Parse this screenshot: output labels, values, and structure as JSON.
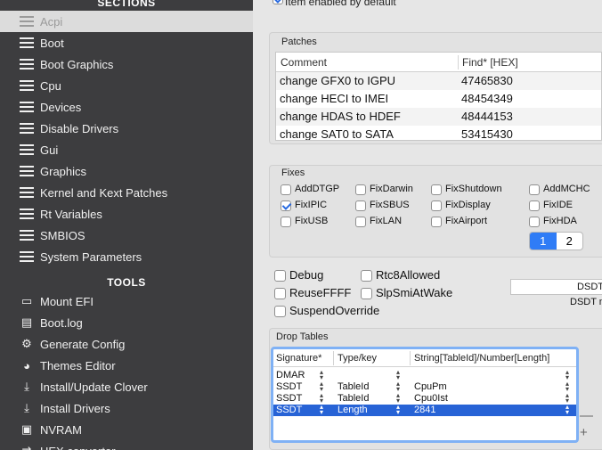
{
  "sidebar": {
    "sections_header": "SECTIONS",
    "tools_header": "TOOLS",
    "items": [
      {
        "label": "Acpi",
        "icon": "list-icon",
        "selected": true
      },
      {
        "label": "Boot",
        "icon": "list-icon"
      },
      {
        "label": "Boot Graphics",
        "icon": "list-icon"
      },
      {
        "label": "Cpu",
        "icon": "list-icon"
      },
      {
        "label": "Devices",
        "icon": "list-icon"
      },
      {
        "label": "Disable Drivers",
        "icon": "list-icon"
      },
      {
        "label": "Gui",
        "icon": "list-icon"
      },
      {
        "label": "Graphics",
        "icon": "list-icon"
      },
      {
        "label": "Kernel and Kext Patches",
        "icon": "list-icon"
      },
      {
        "label": "Rt Variables",
        "icon": "list-icon"
      },
      {
        "label": "SMBIOS",
        "icon": "list-icon"
      },
      {
        "label": "System Parameters",
        "icon": "list-icon"
      }
    ],
    "tools": [
      {
        "label": "Mount EFI",
        "icon": "disk-icon",
        "glyph": "▭"
      },
      {
        "label": "Boot.log",
        "icon": "document-icon",
        "glyph": "▤"
      },
      {
        "label": "Generate Config",
        "icon": "gears-icon",
        "glyph": "⚙"
      },
      {
        "label": "Themes Editor",
        "icon": "palette-icon",
        "glyph": "◕"
      },
      {
        "label": "Install/Update Clover",
        "icon": "download-icon",
        "glyph": "⤓"
      },
      {
        "label": "Install Drivers",
        "icon": "download-tray-icon",
        "glyph": "⤓"
      },
      {
        "label": "NVRAM",
        "icon": "chip-icon",
        "glyph": "▣"
      },
      {
        "label": "HEX converter",
        "icon": "converter-icon",
        "glyph": "⇄"
      }
    ]
  },
  "main": {
    "top_checkbox_label": "Item enabled by default",
    "patches": {
      "title": "Patches",
      "columns": [
        "Comment",
        "Find* [HEX]"
      ],
      "rows": [
        [
          "change GFX0 to IGPU",
          "47465830"
        ],
        [
          "change HECI to IMEI",
          "48454349"
        ],
        [
          "change HDAS to HDEF",
          "48444153"
        ],
        [
          "change SAT0 to SATA",
          "53415430"
        ]
      ]
    },
    "fixes": {
      "title": "Fixes",
      "items": [
        {
          "label": "AddDTGP",
          "checked": false
        },
        {
          "label": "FixDarwin",
          "checked": false
        },
        {
          "label": "FixShutdown",
          "checked": false
        },
        {
          "label": "AddMCHC",
          "checked": false
        },
        {
          "label": "FixIPIC",
          "checked": true
        },
        {
          "label": "FixSBUS",
          "checked": false
        },
        {
          "label": "FixDisplay",
          "checked": false
        },
        {
          "label": "FixIDE",
          "checked": false
        },
        {
          "label": "FixUSB",
          "checked": false
        },
        {
          "label": "FixLAN",
          "checked": false
        },
        {
          "label": "FixAirport",
          "checked": false
        },
        {
          "label": "FixHDA",
          "checked": false
        }
      ],
      "pages": [
        "1",
        "2"
      ],
      "active_page": "1"
    },
    "options": [
      {
        "label": "Debug",
        "checked": false
      },
      {
        "label": "Rtc8Allowed",
        "checked": false
      },
      {
        "label": "ReuseFFFF",
        "checked": false
      },
      {
        "label": "SlpSmiAtWake",
        "checked": false
      },
      {
        "label": "SuspendOverride",
        "checked": false
      }
    ],
    "dsdt": {
      "value": "DSDT",
      "label": "DSDT n"
    },
    "drop_tables": {
      "title": "Drop Tables",
      "columns": [
        "Signature*",
        "Type/key",
        "String[TableId]/Number[Length]"
      ],
      "rows": [
        [
          "DMAR",
          "",
          ""
        ],
        [
          "SSDT",
          "TableId",
          "CpuPm"
        ],
        [
          "SSDT",
          "TableId",
          "Cpu0Ist"
        ],
        [
          "SSDT",
          "Length",
          "2841"
        ]
      ],
      "selected_row": 3,
      "remove_label": "—",
      "add_label": "+"
    }
  },
  "colors": {
    "sidebar_bg": "#3d3d3f",
    "selected_item_bg": "#dcdcdc",
    "accent": "#2f7cf6",
    "selection": "#2763d6"
  }
}
